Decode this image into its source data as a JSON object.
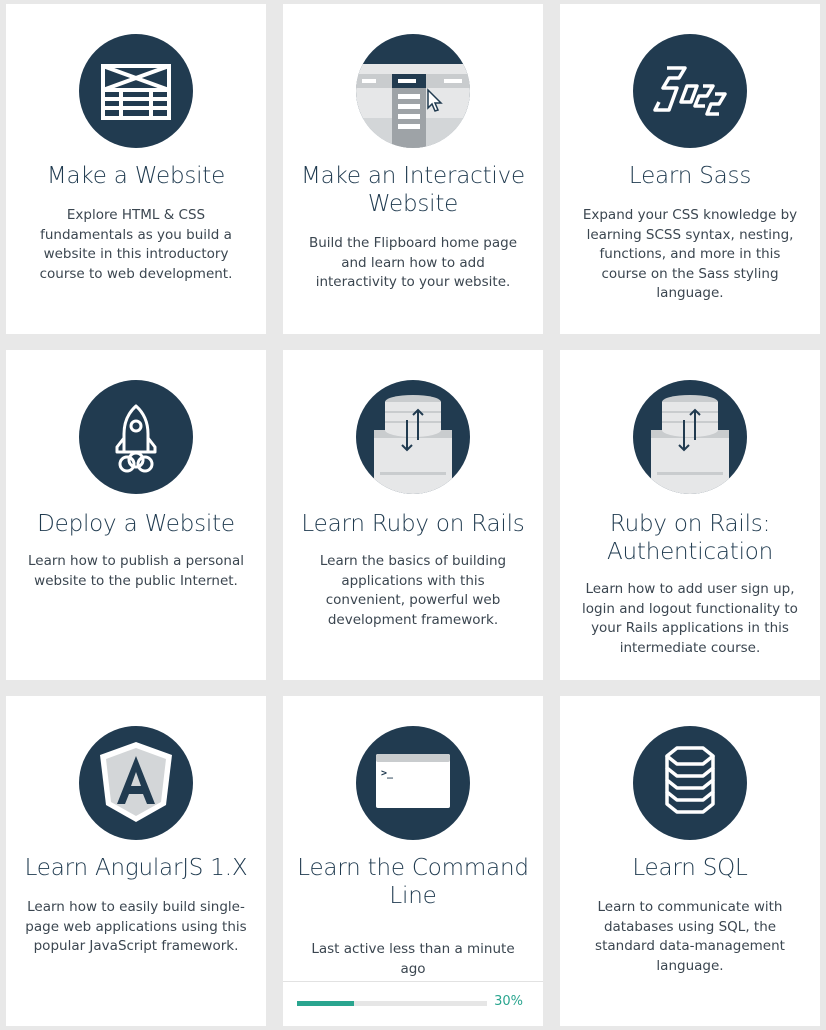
{
  "courses": [
    {
      "title": "Make a Website",
      "description": "Explore HTML & CSS fundamentals as you build a website in this introductory course to web development.",
      "icon": "website-layout-icon"
    },
    {
      "title": "Make an Interactive Website",
      "description": "Build the Flipboard home page and learn how to add interactivity to your website.",
      "icon": "interactive-page-cursor-icon"
    },
    {
      "title": "Learn Sass",
      "description": "Expand your CSS knowledge by learning SCSS syntax, nesting, functions, and more in this course on the Sass styling language.",
      "icon": "sass-logo-icon"
    },
    {
      "title": "Deploy a Website",
      "description": "Learn how to publish a personal website to the public Internet.",
      "icon": "rocket-icon"
    },
    {
      "title": "Learn Ruby on Rails",
      "description": "Learn the basics of building applications with this convenient, powerful web development framework.",
      "icon": "database-browser-sync-icon"
    },
    {
      "title": "Ruby on Rails: Authentication",
      "description": "Learn how to add user sign up, login and logout functionality to your Rails applications in this intermediate course.",
      "icon": "database-browser-sync-icon"
    },
    {
      "title": "Learn AngularJS 1.X",
      "description": "Learn how to easily build single-page web applications using this popular JavaScript framework.",
      "icon": "angular-shield-icon"
    },
    {
      "title": "Learn the Command Line",
      "description": "Last active less than a minute ago",
      "icon": "terminal-window-icon",
      "progress_value": 0.3,
      "progress_label": "30%"
    },
    {
      "title": "Learn SQL",
      "description": "Learn to communicate with databases using SQL, the standard data-management language.",
      "icon": "database-icon"
    }
  ],
  "colors": {
    "icon_circle": "#213b50",
    "progress": "#2aa58f",
    "card_bg": "#ffffff",
    "page_bg": "#e8e8e8"
  }
}
